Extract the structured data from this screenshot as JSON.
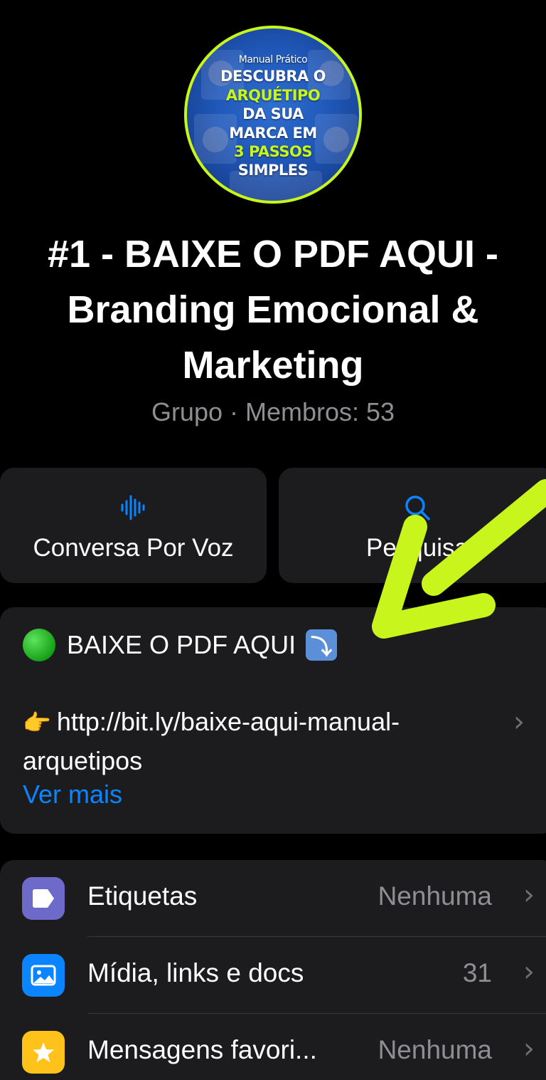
{
  "avatar": {
    "line_small": "Manual Prático",
    "line1": "DESCUBRA O",
    "line2": "ARQUÉTIPO",
    "line3": "DA SUA",
    "line4": "MARCA EM",
    "line5": "3 PASSOS",
    "line6": "SIMPLES"
  },
  "group": {
    "title_line1": "#1 - BAIXE O PDF AQUI -",
    "title_line2": "Branding Emocional &",
    "title_line3": "Marketing",
    "subtitle": "Grupo · Membros: 53"
  },
  "actions": {
    "voice_label": "Conversa Por Voz",
    "search_label": "Pesquisa"
  },
  "description": {
    "headline": "BAIXE O PDF AQUI",
    "link_text": "http://bit.ly/baixe-aqui-manual-arquetipos",
    "more_label": "Ver mais"
  },
  "list": {
    "items": [
      {
        "label": "Etiquetas",
        "value": "Nenhuma",
        "icon": "tag-icon"
      },
      {
        "label": "Mídia, links e docs",
        "value": "31",
        "icon": "photo-icon"
      },
      {
        "label": "Mensagens favori...",
        "value": "Nenhuma",
        "icon": "star-icon"
      }
    ]
  },
  "colors": {
    "accent": "#0a84ff",
    "highlight": "#c8f51b",
    "card": "#1c1c1e",
    "secondary_text": "#8e8e93"
  }
}
